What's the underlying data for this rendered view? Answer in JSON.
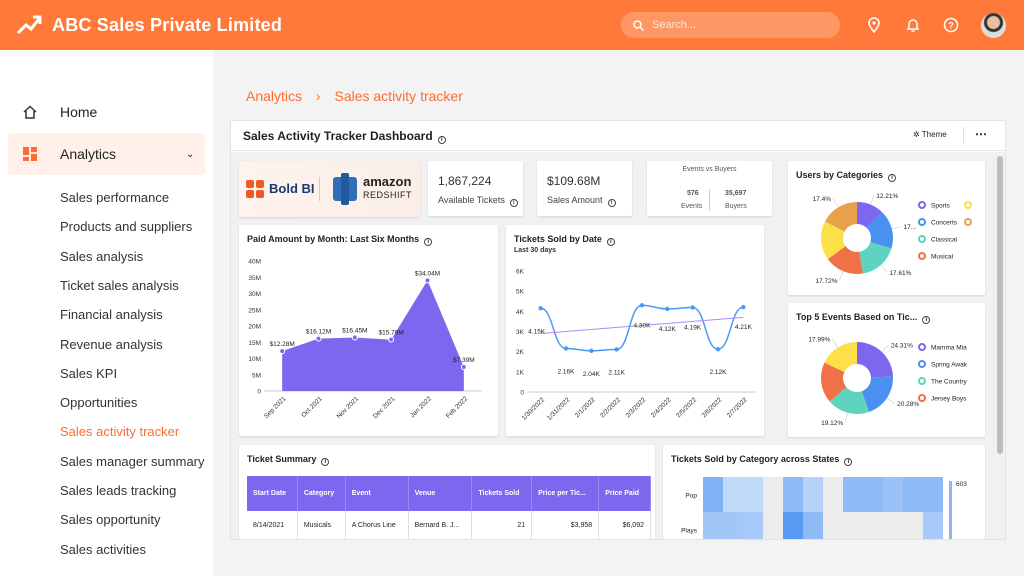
{
  "header": {
    "title": "ABC Sales Private Limited",
    "search_placeholder": "Search...",
    "brand_color": "#ff7a3a"
  },
  "sidebar": {
    "home": "Home",
    "analytics": "Analytics",
    "items": [
      "Sales performance",
      "Products and suppliers",
      "Sales analysis",
      "Ticket sales analysis",
      "Financial analysis",
      "Revenue analysis",
      "Sales KPI",
      "Opportunities",
      "Sales activity tracker",
      "Sales manager summary",
      "Sales leads tracking",
      "Sales opportunity",
      "Sales activities"
    ],
    "current": "Sales activity tracker"
  },
  "breadcrumb": {
    "parent": "Analytics",
    "sep": "›",
    "current": "Sales activity tracker"
  },
  "dashboard": {
    "title": "Sales Activity Tracker Dashboard",
    "theme_label": "Theme",
    "more": "⋯",
    "logos": {
      "boldbi": "Bold BI",
      "amazon": "amazon",
      "redshift": "REDSHIFT"
    },
    "kpis": [
      {
        "value": "1,867,224",
        "label": "Available Tickets"
      },
      {
        "value": "$109.68M",
        "label": "Sales Amount"
      }
    ],
    "events_vs_buyers": {
      "title": "Events vs Buyers",
      "events_value": "576",
      "events_label": "Events",
      "buyers_value": "35,697",
      "buyers_label": "Buyers"
    },
    "ticket_summary": {
      "title": "Ticket Summary",
      "columns": [
        "Start Date",
        "Category",
        "Event",
        "Venue",
        "Tickets Sold",
        "Price per Tic...",
        "Price Paid"
      ],
      "rows": [
        [
          "8/14/2021",
          "Musicals",
          "A Chorus Line",
          "Bernard B. J...",
          "21",
          "$3,958",
          "$6,092"
        ]
      ]
    },
    "heatmap": {
      "title": "Tickets Sold by Category across States",
      "rows": [
        "Pop",
        "Plays"
      ],
      "legend_max": "603"
    }
  },
  "chart_data": [
    {
      "type": "area",
      "title": "Paid Amount by Month: Last Six Months",
      "categories": [
        "Sep 2021",
        "Oct 2021",
        "Nov 2021",
        "Dec 2021",
        "Jan 2022",
        "Feb 2022"
      ],
      "values": [
        12.28,
        16.12,
        16.45,
        15.79,
        34.04,
        7.39
      ],
      "labels": [
        "$12.28M",
        "$16.12M",
        "$16.45M",
        "$15.79M",
        "$34.04M",
        "$7.39M"
      ],
      "yticks": [
        "0",
        "5M",
        "10M",
        "15M",
        "20M",
        "25M",
        "30M",
        "35M",
        "40M"
      ],
      "ylim": [
        0,
        40
      ],
      "color": "#7b68ee"
    },
    {
      "type": "line",
      "title": "Tickets Sold by Date",
      "subtitle": "Last 30 days",
      "categories": [
        "1/30/2022",
        "1/31/2022",
        "2/1/2022",
        "2/2/2022",
        "2/3/2022",
        "2/4/2022",
        "2/5/2022",
        "2/6/2022",
        "2/7/2022"
      ],
      "values": [
        4.15,
        2.16,
        2.04,
        2.11,
        4.3,
        4.12,
        4.19,
        2.12,
        4.21
      ],
      "labels": [
        "4.15K",
        "2.16K",
        "2.04K",
        "2.11K",
        "4.30K",
        "4.12K",
        "4.19K",
        "2.12K",
        "4.21K"
      ],
      "trend": [
        2.9,
        3.7
      ],
      "yticks": [
        "0",
        "1K",
        "2K",
        "3K",
        "4K",
        "5K",
        "6K"
      ],
      "ylim": [
        0,
        6
      ],
      "color": "#4a9af5",
      "trend_color": "#a78bfa"
    },
    {
      "type": "pie",
      "title": "Users by Categories",
      "slices": [
        {
          "name": "Sports",
          "value": 12.21,
          "label": "12.21%",
          "color": "#7b68ee"
        },
        {
          "name": "Concerts",
          "value": 17.53,
          "label": "17...",
          "color": "#4a90f0"
        },
        {
          "name": "Classical",
          "value": 17.61,
          "label": "17.61%",
          "color": "#5fd3c0"
        },
        {
          "name": "Musical",
          "value": 17.72,
          "label": "17.72%",
          "color": "#f07048"
        },
        {
          "name": "",
          "value": 17.53,
          "label": "",
          "color": "#fde047"
        },
        {
          "name": "",
          "value": 17.4,
          "label": "17.4%",
          "color": "#e8a04a"
        }
      ]
    },
    {
      "type": "pie",
      "title": "Top 5 Events Based on Tic...",
      "slices": [
        {
          "name": "Mamma Mia",
          "value": 24.31,
          "label": "24.31%",
          "color": "#7b68ee"
        },
        {
          "name": "Spring Awak",
          "value": 20.28,
          "label": "20.28%",
          "color": "#4a90f0"
        },
        {
          "name": "The Country",
          "value": 19.12,
          "label": "19.12%",
          "color": "#5fd3c0"
        },
        {
          "name": "Jersey Boys",
          "value": 18.3,
          "label": "",
          "color": "#f07048"
        },
        {
          "name": "",
          "value": 17.99,
          "label": "17.99%",
          "color": "#fde047"
        }
      ]
    }
  ]
}
